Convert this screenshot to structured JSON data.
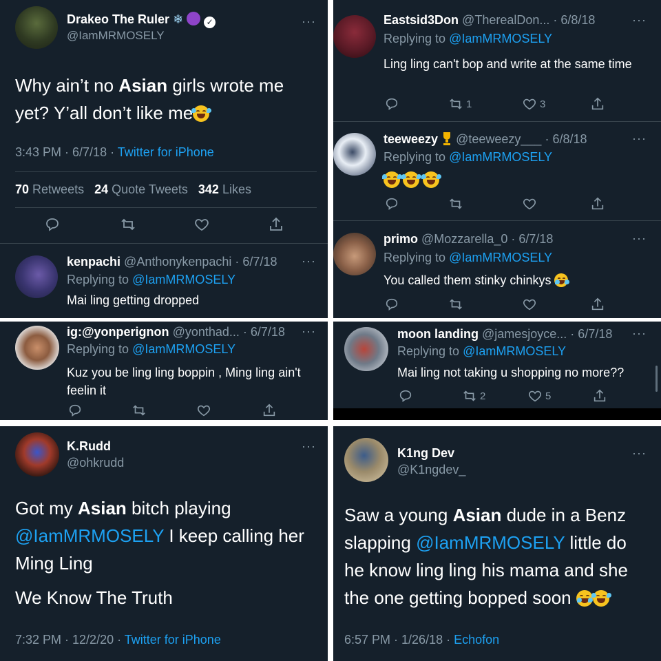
{
  "p1": {
    "author": "Drakeo The Ruler",
    "handle": "@IamMRMOSELY",
    "text_before": "Why ain’t no ",
    "text_bold": "Asian",
    "text_after": " girls wrote me yet? Y’all don’t like me",
    "time": "3:43 PM · 6/7/18 · ",
    "source": "Twitter for iPhone",
    "retweets": "70",
    "retweets_label": "Retweets",
    "quotes": "24",
    "quotes_label": "Quote Tweets",
    "likes": "342",
    "likes_label": "Likes",
    "reply": {
      "name": "kenpachi",
      "handle": "@Anthonykenpachi · 6/7/18",
      "replying_label": "Replying to ",
      "replying_to": "@IamMRMOSELY",
      "text": "Mai ling getting dropped"
    }
  },
  "p2": {
    "replies": [
      {
        "name": "Eastsid3Don",
        "handle": "@TherealDon... · 6/8/18",
        "replying_label": "Replying to ",
        "replying_to": "@IamMRMOSELY",
        "text": "Ling ling can't bop and write at the same time",
        "retweets": "1",
        "likes": "3"
      },
      {
        "name": "teeweezy",
        "handle": "@teeweezy___ · 6/8/18",
        "replying_label": "Replying to ",
        "replying_to": "@IamMRMOSELY"
      },
      {
        "name": "primo",
        "handle": "@Mozzarella_0 · 6/7/18",
        "replying_label": "Replying to ",
        "replying_to": "@IamMRMOSELY",
        "text": "You called them stinky chinkys"
      }
    ]
  },
  "p3": {
    "name": "ig:@yonperignon",
    "handle": "@yonthad... · 6/7/18",
    "replying_label": "Replying to ",
    "replying_to": "@IamMRMOSELY",
    "text": "Kuz you be ling ling boppin , Ming ling ain't feelin it"
  },
  "p4": {
    "name": "moon landing",
    "handle": "@jamesjoyce... · 6/7/18",
    "replying_label": "Replying to ",
    "replying_to": "@IamMRMOSELY",
    "text": "Mai ling not taking u shopping no more??",
    "retweets": "2",
    "likes": "5"
  },
  "p5": {
    "name": "K.Rudd",
    "handle": "@ohkrudd",
    "line1_before": "Got my ",
    "line1_bold": "Asian",
    "line1_after": " bitch playing",
    "mention": "@IamMRMOSELY",
    "line2_after": " I keep calling her Ming Ling",
    "line3": "We Know The Truth",
    "time": "7:32 PM · 12/2/20 · ",
    "source": "Twitter for iPhone"
  },
  "p6": {
    "name": "K1ng Dev",
    "handle": "@K1ngdev_",
    "text_before": "Saw a young ",
    "text_bold": "Asian",
    "text_mid": " dude in a Benz slapping ",
    "mention": "@IamMRMOSELY",
    "text_after": " little do he know ling ling his mama and she the one getting bopped soon",
    "time": "6:57 PM · 1/26/18 · ",
    "source": "Echofon"
  },
  "colors": {
    "background": "#15202b",
    "link": "#1da1f2",
    "muted": "#8899a6",
    "divider": "#38444d"
  },
  "icons": {
    "reply": "reply-icon",
    "retweet": "retweet-icon",
    "like": "heart-icon",
    "share": "share-icon",
    "more": "more-icon"
  }
}
